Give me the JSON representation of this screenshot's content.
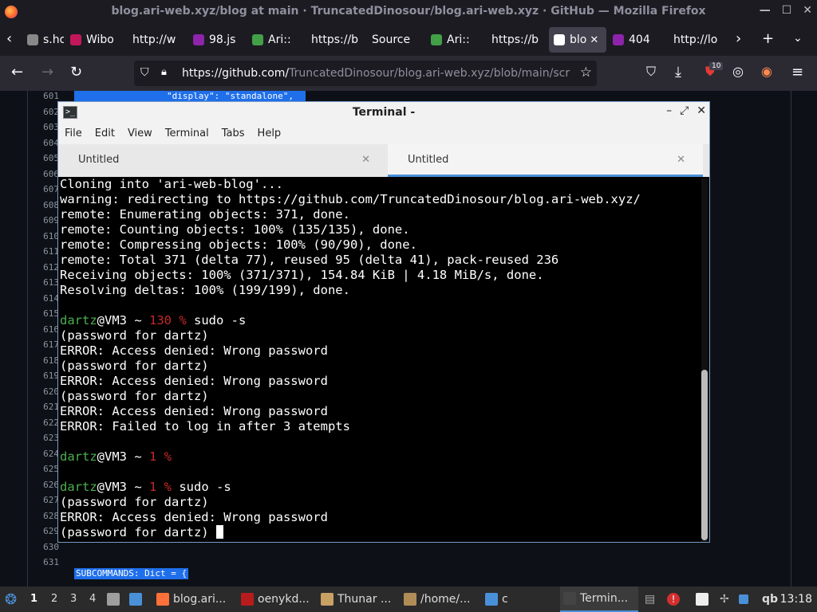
{
  "firefox": {
    "title": "blog.ari-web.xyz/blog at main · TruncatedDinosour/blog.ari-web.xyz · GitHub — Mozilla Firefox",
    "tabs": [
      {
        "label": "s.hol",
        "color": "#888"
      },
      {
        "label": "Wibo",
        "color": "#c2185b"
      },
      {
        "label": "http://w",
        "color": ""
      },
      {
        "label": "98.js",
        "color": "#8e24aa"
      },
      {
        "label": "Ari::",
        "color": "#43a047"
      },
      {
        "label": "https://b",
        "color": ""
      },
      {
        "label": "Source",
        "color": ""
      },
      {
        "label": "Ari::",
        "color": "#43a047"
      },
      {
        "label": "https://b",
        "color": ""
      },
      {
        "label": "blo",
        "color": "#ffffff"
      },
      {
        "label": "404",
        "color": "#8e24aa"
      },
      {
        "label": "http://lo",
        "color": ""
      }
    ],
    "url_host": "https://github.com/",
    "url_path": "TruncatedDinosour/blog.ari-web.xyz/blob/main/scr",
    "badge": "10"
  },
  "github": {
    "line_numbers": [
      "601",
      "602",
      "603",
      "604",
      "605",
      "606",
      "607",
      "608",
      "609",
      "610",
      "611",
      "612",
      "613",
      "614",
      "615",
      "616",
      "617",
      "618",
      "619",
      "620",
      "621",
      "622",
      "623",
      "624",
      "625",
      "626",
      "627",
      "628",
      "629",
      "630",
      "631"
    ],
    "code_top": "\"display\": \"standalone\",",
    "code_bottom": "SUBCOMMANDS: Dict = {"
  },
  "terminal": {
    "title": "Terminal -",
    "menu": [
      "File",
      "Edit",
      "View",
      "Terminal",
      "Tabs",
      "Help"
    ],
    "tabs": [
      "Untitled",
      "Untitled"
    ],
    "lines": [
      [
        {
          "t": "Cloning into 'ari-web-blog'..."
        }
      ],
      [
        {
          "t": "warning: redirecting to https://github.com/TruncatedDinosour/blog.ari-web.xyz/"
        }
      ],
      [
        {
          "t": "remote: Enumerating objects: 371, done."
        }
      ],
      [
        {
          "t": "remote: Counting objects: 100% (135/135), done."
        }
      ],
      [
        {
          "t": "remote: Compressing objects: 100% (90/90), done."
        }
      ],
      [
        {
          "t": "remote: Total 371 (delta 77), reused 95 (delta 41), pack-reused 236"
        }
      ],
      [
        {
          "t": "Receiving objects: 100% (371/371), 154.84 KiB | 4.18 MiB/s, done."
        }
      ],
      [
        {
          "t": "Resolving deltas: 100% (199/199), done."
        }
      ],
      [
        {
          "t": ""
        }
      ],
      [
        {
          "t": "dartz",
          "c": "g"
        },
        {
          "t": "@VM3 ~ "
        },
        {
          "t": "130 %",
          "c": "r"
        },
        {
          "t": " sudo -s"
        }
      ],
      [
        {
          "t": "(password for dartz)"
        }
      ],
      [
        {
          "t": "ERROR: Access denied: Wrong password"
        }
      ],
      [
        {
          "t": "(password for dartz)"
        }
      ],
      [
        {
          "t": "ERROR: Access denied: Wrong password"
        }
      ],
      [
        {
          "t": "(password for dartz)"
        }
      ],
      [
        {
          "t": "ERROR: Access denied: Wrong password"
        }
      ],
      [
        {
          "t": "ERROR: Failed to log in after 3 atempts"
        }
      ],
      [
        {
          "t": ""
        }
      ],
      [
        {
          "t": "dartz",
          "c": "g"
        },
        {
          "t": "@VM3 ~ "
        },
        {
          "t": "1 %",
          "c": "r"
        }
      ],
      [
        {
          "t": ""
        }
      ],
      [
        {
          "t": "dartz",
          "c": "g"
        },
        {
          "t": "@VM3 ~ "
        },
        {
          "t": "1 %",
          "c": "r"
        },
        {
          "t": " sudo -s"
        }
      ],
      [
        {
          "t": "(password for dartz)"
        }
      ],
      [
        {
          "t": "ERROR: Access denied: Wrong password"
        }
      ],
      [
        {
          "t": "(password for dartz) "
        },
        {
          "t": "",
          "c": "cursor"
        }
      ]
    ]
  },
  "taskbar": {
    "workspaces": [
      "1",
      "2",
      "3",
      "4"
    ],
    "items": [
      {
        "label": "blog.ari...",
        "icon": "firefox-icon",
        "color": "#ff7139"
      },
      {
        "label": "oenykd...",
        "icon": "filezilla-icon",
        "color": "#b71c1c"
      },
      {
        "label": "Thunar ...",
        "icon": "folder-icon",
        "color": "#c8a165"
      },
      {
        "label": "/home/...",
        "icon": "archive-icon",
        "color": "#b08d57"
      },
      {
        "label": "c",
        "icon": "window-icon",
        "color": "#4a90d9"
      },
      {
        "label": "Termin...",
        "icon": "terminal-icon",
        "color": "#444"
      }
    ],
    "tray_label": "qb",
    "clock": "13:18"
  }
}
